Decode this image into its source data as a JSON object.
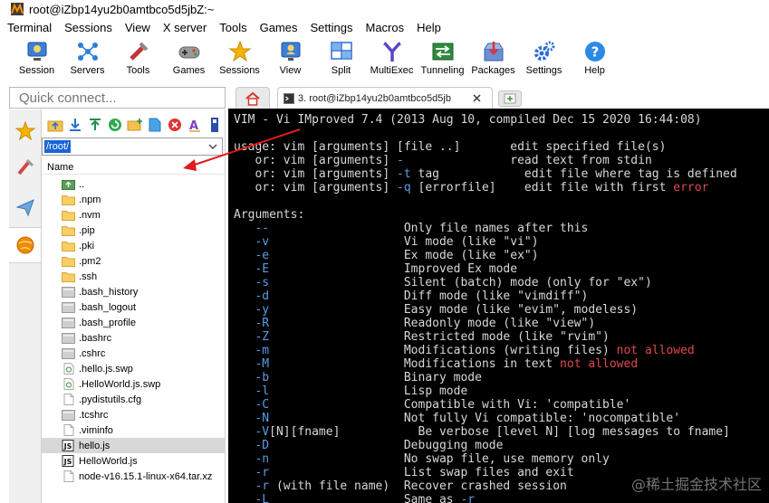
{
  "window": {
    "title": "root@iZbp14yu2b0amtbco5d5jbZ:~"
  },
  "menu": [
    "Terminal",
    "Sessions",
    "View",
    "X server",
    "Tools",
    "Games",
    "Settings",
    "Macros",
    "Help"
  ],
  "toolbar": [
    {
      "label": "Session",
      "icon": "session-icon"
    },
    {
      "label": "Servers",
      "icon": "servers-icon"
    },
    {
      "label": "Tools",
      "icon": "tools-icon"
    },
    {
      "label": "Games",
      "icon": "games-icon"
    },
    {
      "label": "Sessions",
      "icon": "sessions-star-icon"
    },
    {
      "label": "View",
      "icon": "view-icon"
    },
    {
      "label": "Split",
      "icon": "split-icon"
    },
    {
      "label": "MultiExec",
      "icon": "multiexec-icon"
    },
    {
      "label": "Tunneling",
      "icon": "tunneling-icon"
    },
    {
      "label": "Packages",
      "icon": "packages-icon"
    },
    {
      "label": "Settings",
      "icon": "settings-icon"
    },
    {
      "label": "Help",
      "icon": "help-icon"
    }
  ],
  "quick_connect": {
    "placeholder": "Quick connect..."
  },
  "tabs": {
    "active_label": "3. root@iZbp14yu2b0amtbco5d5jb"
  },
  "file_panel": {
    "path": "/root/",
    "column_header": "Name",
    "files": [
      {
        "name": "..",
        "kind": "parent"
      },
      {
        "name": ".npm",
        "kind": "folder"
      },
      {
        "name": ".nvm",
        "kind": "folder"
      },
      {
        "name": ".pip",
        "kind": "folder"
      },
      {
        "name": ".pki",
        "kind": "folder"
      },
      {
        "name": ".pm2",
        "kind": "folder"
      },
      {
        "name": ".ssh",
        "kind": "folder"
      },
      {
        "name": ".bash_history",
        "kind": "file"
      },
      {
        "name": ".bash_logout",
        "kind": "file"
      },
      {
        "name": ".bash_profile",
        "kind": "file"
      },
      {
        "name": ".bashrc",
        "kind": "file"
      },
      {
        "name": ".cshrc",
        "kind": "file"
      },
      {
        "name": ".hello.js.swp",
        "kind": "swap"
      },
      {
        "name": ".HelloWorld.js.swp",
        "kind": "swap"
      },
      {
        "name": ".pydistutils.cfg",
        "kind": "doc"
      },
      {
        "name": ".tcshrc",
        "kind": "file"
      },
      {
        "name": ".viminfo",
        "kind": "doc"
      },
      {
        "name": "hello.js",
        "kind": "js",
        "selected": true
      },
      {
        "name": "HelloWorld.js",
        "kind": "js"
      },
      {
        "name": "node-v16.15.1-linux-x64.tar.xz",
        "kind": "doc"
      }
    ]
  },
  "terminal": {
    "lines": [
      [
        {
          "t": "VIM - Vi IMproved 7.4 (2013 Aug 10, compiled Dec 15 2020 16:44:08)"
        }
      ],
      [],
      [
        {
          "t": "usage: vim [arguments] [file ..]       edit specified file(s)"
        }
      ],
      [
        {
          "t": "   or: vim [arguments] "
        },
        {
          "t": "-",
          "c": "hl"
        },
        {
          "t": "               read text from stdin"
        }
      ],
      [
        {
          "t": "   or: vim [arguments] "
        },
        {
          "t": "-t",
          "c": "hl"
        },
        {
          "t": " tag            edit file where tag is defined"
        }
      ],
      [
        {
          "t": "   or: vim [arguments] "
        },
        {
          "t": "-q",
          "c": "hl"
        },
        {
          "t": " [errorfile]    edit file with first "
        },
        {
          "t": "error",
          "c": "red"
        }
      ],
      [],
      [
        {
          "t": "Arguments:"
        }
      ],
      [
        {
          "t": "   "
        },
        {
          "t": "--",
          "c": "hl"
        },
        {
          "t": "                   Only file names after this"
        }
      ],
      [
        {
          "t": "   "
        },
        {
          "t": "-v",
          "c": "hl"
        },
        {
          "t": "                   Vi mode (like \"vi\")"
        }
      ],
      [
        {
          "t": "   "
        },
        {
          "t": "-e",
          "c": "hl"
        },
        {
          "t": "                   Ex mode (like \"ex\")"
        }
      ],
      [
        {
          "t": "   "
        },
        {
          "t": "-E",
          "c": "hl"
        },
        {
          "t": "                   Improved Ex mode"
        }
      ],
      [
        {
          "t": "   "
        },
        {
          "t": "-s",
          "c": "hl"
        },
        {
          "t": "                   Silent (batch) mode (only for \"ex\")"
        }
      ],
      [
        {
          "t": "   "
        },
        {
          "t": "-d",
          "c": "hl"
        },
        {
          "t": "                   Diff mode (like \"vimdiff\")"
        }
      ],
      [
        {
          "t": "   "
        },
        {
          "t": "-y",
          "c": "hl"
        },
        {
          "t": "                   Easy mode (like \"evim\", modeless)"
        }
      ],
      [
        {
          "t": "   "
        },
        {
          "t": "-R",
          "c": "hl"
        },
        {
          "t": "                   Readonly mode (like \"view\")"
        }
      ],
      [
        {
          "t": "   "
        },
        {
          "t": "-Z",
          "c": "hl"
        },
        {
          "t": "                   Restricted mode (like \"rvim\")"
        }
      ],
      [
        {
          "t": "   "
        },
        {
          "t": "-m",
          "c": "hl"
        },
        {
          "t": "                   Modifications (writing files) "
        },
        {
          "t": "not allowed",
          "c": "red"
        }
      ],
      [
        {
          "t": "   "
        },
        {
          "t": "-M",
          "c": "hl"
        },
        {
          "t": "                   Modifications in text "
        },
        {
          "t": "not allowed",
          "c": "red"
        }
      ],
      [
        {
          "t": "   "
        },
        {
          "t": "-b",
          "c": "hl"
        },
        {
          "t": "                   Binary mode"
        }
      ],
      [
        {
          "t": "   "
        },
        {
          "t": "-l",
          "c": "hl"
        },
        {
          "t": "                   Lisp mode"
        }
      ],
      [
        {
          "t": "   "
        },
        {
          "t": "-C",
          "c": "hl"
        },
        {
          "t": "                   Compatible with Vi: 'compatible'"
        }
      ],
      [
        {
          "t": "   "
        },
        {
          "t": "-N",
          "c": "hl"
        },
        {
          "t": "                   Not fully Vi compatible: 'nocompatible'"
        }
      ],
      [
        {
          "t": "   "
        },
        {
          "t": "-V",
          "c": "hl"
        },
        {
          "t": "[N][fname]           Be verbose [level N] [log messages to fname]"
        }
      ],
      [
        {
          "t": "   "
        },
        {
          "t": "-D",
          "c": "hl"
        },
        {
          "t": "                   Debugging mode"
        }
      ],
      [
        {
          "t": "   "
        },
        {
          "t": "-n",
          "c": "hl"
        },
        {
          "t": "                   No swap file, use memory only"
        }
      ],
      [
        {
          "t": "   "
        },
        {
          "t": "-r",
          "c": "hl"
        },
        {
          "t": "                   List swap files and exit"
        }
      ],
      [
        {
          "t": "   "
        },
        {
          "t": "-r",
          "c": "hl"
        },
        {
          "t": " (with file name)  Recover crashed session"
        }
      ],
      [
        {
          "t": "   "
        },
        {
          "t": "-L",
          "c": "hl"
        },
        {
          "t": "                   Same as "
        },
        {
          "t": "-r",
          "c": "hl"
        }
      ]
    ]
  },
  "watermark": "@稀土掘金技术社区",
  "colors": {
    "accent_blue": "#1a64d6",
    "term_highlight": "#5a9ee6",
    "term_error": "#e0474c",
    "annotation_red": "#e01b1b"
  }
}
